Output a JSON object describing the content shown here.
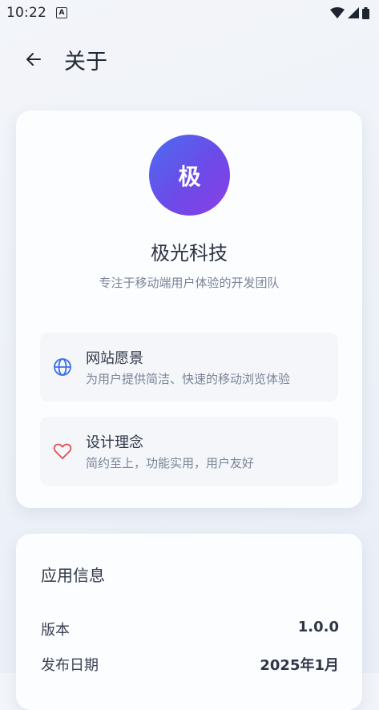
{
  "status_bar": {
    "time": "10:22",
    "notification_icon": "A"
  },
  "header": {
    "title": "关于"
  },
  "company": {
    "logo_text": "极",
    "name": "极光科技",
    "tagline": "专注于移动端用户体验的开发团队"
  },
  "features": [
    {
      "icon": "globe-icon",
      "title": "网站愿景",
      "desc": "为用户提供简洁、快速的移动浏览体验",
      "icon_color": "#3b6fe6"
    },
    {
      "icon": "heart-icon",
      "title": "设计理念",
      "desc": "简约至上，功能实用，用户友好",
      "icon_color": "#e04f4f"
    }
  ],
  "app_info": {
    "title": "应用信息",
    "rows": [
      {
        "label": "版本",
        "value": "1.0.0"
      },
      {
        "label": "发布日期",
        "value": "2025年1月"
      }
    ]
  },
  "colors": {
    "accent_start": "#4a6cf0",
    "accent_end": "#8b3fe4"
  }
}
